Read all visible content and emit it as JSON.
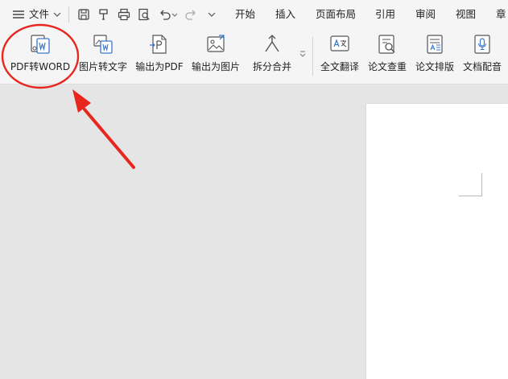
{
  "menubar": {
    "file_label": "文件",
    "tabs": [
      "开始",
      "插入",
      "页面布局",
      "引用",
      "审阅",
      "视图",
      "章"
    ]
  },
  "ribbon": {
    "tools": [
      {
        "label": "PDF转WORD",
        "icon": "pdf-to-word-icon"
      },
      {
        "label": "图片转文字",
        "icon": "image-to-text-icon"
      },
      {
        "label": "输出为PDF",
        "icon": "export-pdf-icon"
      },
      {
        "label": "输出为图片",
        "icon": "export-image-icon"
      },
      {
        "label": "拆分合并",
        "icon": "split-merge-icon"
      },
      {
        "label": "全文翻译",
        "icon": "translate-icon"
      },
      {
        "label": "论文查重",
        "icon": "plagiarism-check-icon"
      },
      {
        "label": "论文排版",
        "icon": "paper-format-icon"
      },
      {
        "label": "文档配音",
        "icon": "document-voice-icon"
      }
    ]
  },
  "colors": {
    "accent": "#3a77c9",
    "annotation": "#e8261e",
    "toolbar_bg": "#f5f5f5",
    "canvas_bg": "#e5e5e5"
  }
}
